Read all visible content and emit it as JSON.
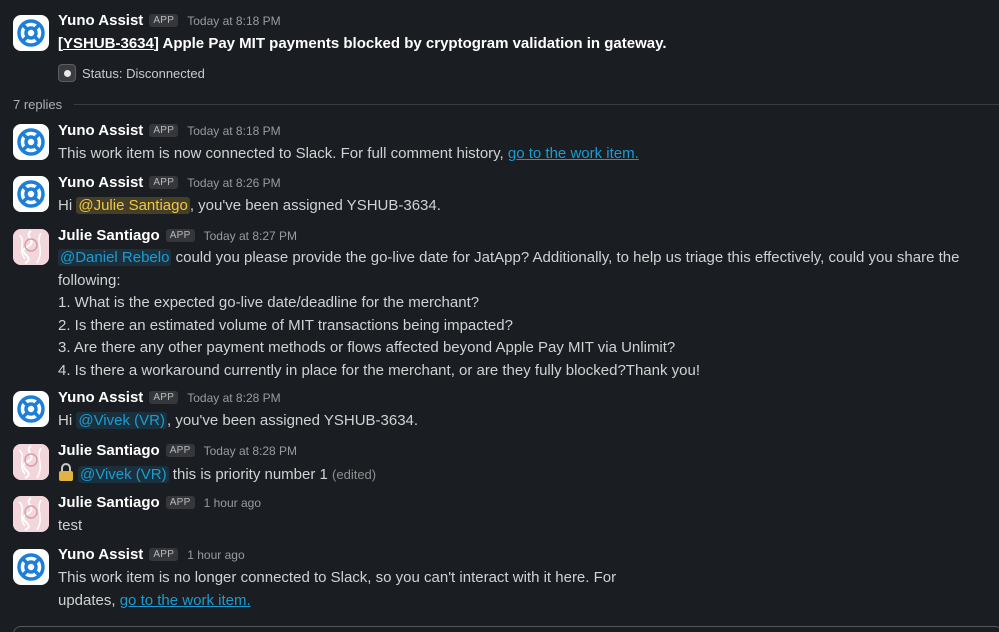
{
  "thread": {
    "parent": {
      "sender": "Yuno Assist",
      "badge": "APP",
      "time": "Today at 8:18 PM",
      "ticket_id": "YSHUB-3634",
      "title": "Apple Pay MIT payments blocked by cryptogram validation in gateway.",
      "status": "Status: Disconnected"
    },
    "replies_label": "7 replies",
    "messages": [
      {
        "sender": "Yuno Assist",
        "badge": "APP",
        "time": "Today at 8:18 PM",
        "text": "This work item is now connected to Slack. For full comment history, ",
        "link": "go to the work item."
      },
      {
        "sender": "Yuno Assist",
        "badge": "APP",
        "time": "Today at 8:26 PM",
        "pre": "Hi ",
        "mention": "@Julie Santiago",
        "post": ", you've been assigned YSHUB-3634."
      },
      {
        "sender": "Julie Santiago",
        "badge": "APP",
        "time": "Today at 8:27 PM",
        "mention": "@Daniel Rebelo",
        "text": " could you please provide the go-live date for JatApp? Additionally, to help us triage this effectively, could you share the following:",
        "items": [
          "1. What is the expected go-live date/deadline for the merchant?",
          "2. Is there an estimated volume of MIT transactions being impacted?",
          "3. Are there any other payment methods or flows affected beyond Apple Pay MIT via Unlimit?",
          "4. Is there a workaround currently in place for the merchant, or are they fully blocked?Thank you!"
        ]
      },
      {
        "sender": "Yuno Assist",
        "badge": "APP",
        "time": "Today at 8:28 PM",
        "pre": "Hi ",
        "mention": "@Vivek (VR)",
        "post": ", you've been assigned YSHUB-3634."
      },
      {
        "sender": "Julie Santiago",
        "badge": "APP",
        "time": "Today at 8:28 PM",
        "mention": "@Vivek (VR)",
        "text": " this is priority number 1 ",
        "edited": "(edited)"
      },
      {
        "sender": "Julie Santiago",
        "badge": "APP",
        "time": "1 hour ago",
        "text": "test"
      },
      {
        "sender": "Yuno Assist",
        "badge": "APP",
        "time": "1 hour ago",
        "line1": "This work item is no longer connected to Slack, so you can't interact with it here. For",
        "line2": "updates, ",
        "link": "go to the work item."
      }
    ]
  },
  "colors": {
    "background": "#1a1d21",
    "link": "#1d9bd1",
    "self_mention": "#f2c744",
    "bot_icon": "#1e7fd9"
  },
  "icons": {
    "bot_avatar": "lifebuoy-icon",
    "user_avatar": "sketch-avatar",
    "status": "status-dot-icon",
    "lock": "lock-icon"
  }
}
